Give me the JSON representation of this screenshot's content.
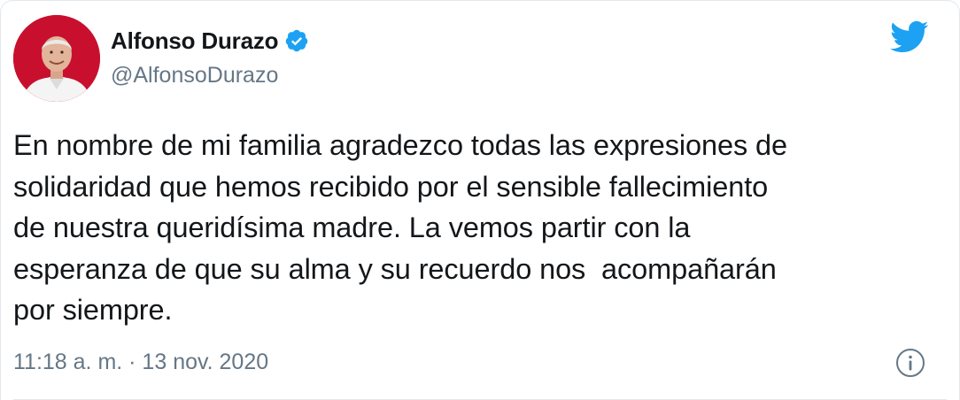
{
  "author": {
    "name": "Alfonso Durazo",
    "handle": "@AlfonsoDurazo",
    "verified": true
  },
  "tweet": {
    "text": "En nombre de mi familia agradezco todas las expresiones de\nsolidaridad que hemos recibido por el sensible fallecimiento\nde nuestra queridísima madre. La vemos partir con la\nesperanza de que su alma y su recuerdo nos  acompañarán\npor siempre.",
    "timestamp": "11:18 a. m. · 13 nov. 2020"
  },
  "icons": {
    "verified": "verified-badge-icon",
    "brand": "twitter-bird-icon",
    "info": "info-circle-icon"
  },
  "colors": {
    "brand_blue": "#1da1f2",
    "text": "#14171a",
    "secondary_text": "#657786",
    "avatar_background": "#c8102e"
  }
}
